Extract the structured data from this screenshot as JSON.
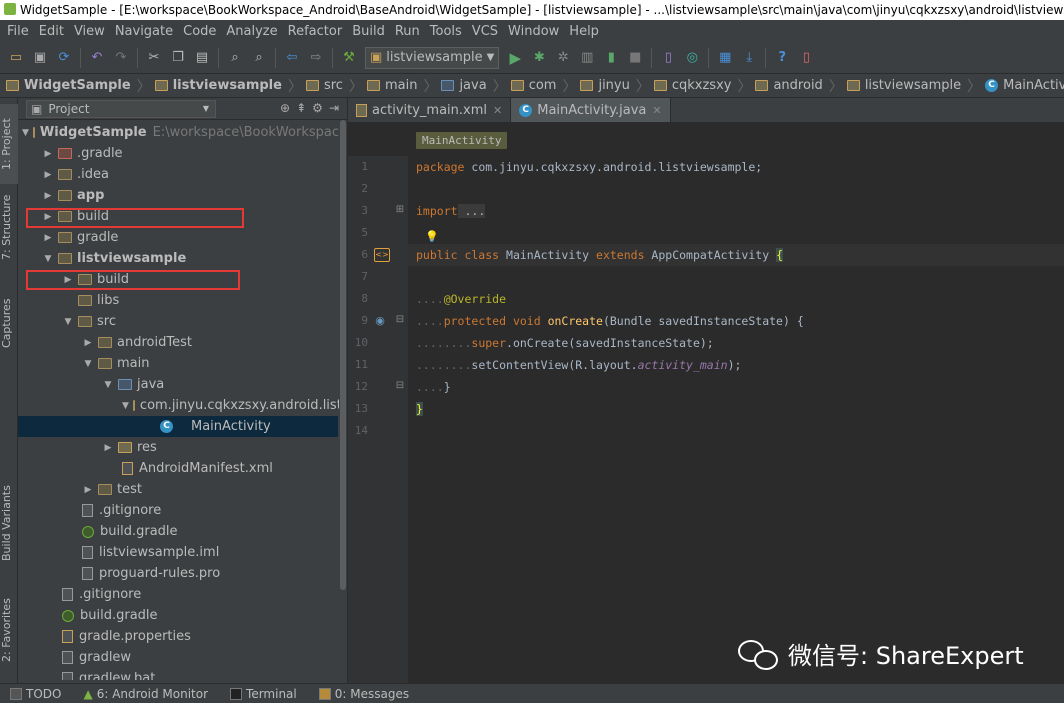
{
  "window": {
    "title": "WidgetSample - [E:\\workspace\\BookWorkspace_Android\\BaseAndroid\\WidgetSample] - [listviewsample] - ...\\listviewsample\\src\\main\\java\\com\\jinyu\\cqkxzsxy\\android\\listviewsample"
  },
  "menu": [
    "File",
    "Edit",
    "View",
    "Navigate",
    "Code",
    "Analyze",
    "Refactor",
    "Build",
    "Run",
    "Tools",
    "VCS",
    "Window",
    "Help"
  ],
  "toolbar": {
    "run_config": "listviewsample"
  },
  "navbar": [
    "WidgetSample",
    "listviewsample",
    "src",
    "main",
    "java",
    "com",
    "jinyu",
    "cqkxzsxy",
    "android",
    "listviewsample",
    "MainActivity"
  ],
  "sidebar_tabs": {
    "project": "1: Project",
    "structure": "7: Structure",
    "captures": "Captures",
    "build_variants": "Build Variants",
    "favorites": "2: Favorites"
  },
  "project": {
    "header": "Project",
    "root": {
      "name": "WidgetSample",
      "path": "E:\\workspace\\BookWorkspace_A"
    },
    "items": [
      {
        "name": ".gradle"
      },
      {
        "name": ".idea"
      },
      {
        "name": "app"
      },
      {
        "name": "build"
      },
      {
        "name": "gradle"
      },
      {
        "name": "listviewsample"
      },
      {
        "name": "build"
      },
      {
        "name": "libs"
      },
      {
        "name": "src"
      },
      {
        "name": "androidTest"
      },
      {
        "name": "main"
      },
      {
        "name": "java"
      },
      {
        "name": "com.jinyu.cqkxzsxy.android.listvie"
      },
      {
        "name": "MainActivity"
      },
      {
        "name": "res"
      },
      {
        "name": "AndroidManifest.xml"
      },
      {
        "name": "test"
      },
      {
        "name": ".gitignore"
      },
      {
        "name": "build.gradle"
      },
      {
        "name": "listviewsample.iml"
      },
      {
        "name": "proguard-rules.pro"
      },
      {
        "name": ".gitignore"
      },
      {
        "name": "build.gradle"
      },
      {
        "name": "gradle.properties"
      },
      {
        "name": "gradlew"
      },
      {
        "name": "gradlew.bat"
      }
    ]
  },
  "editor": {
    "tabs": [
      {
        "label": "activity_main.xml"
      },
      {
        "label": "MainActivity.java"
      }
    ],
    "breadcrumb": "MainActivity",
    "line_numbers": [
      "1",
      "2",
      "3",
      "5",
      "6",
      "7",
      "8",
      "9",
      "10",
      "11",
      "12",
      "13",
      "14"
    ],
    "code": {
      "l1_kw": "package",
      "l1_rest": " com.jinyu.cqkxzsxy.android.listviewsample;",
      "l3_kw": "import",
      "l3_rest": " ...",
      "l6_kw1": "public class",
      "l6_name": " MainActivity ",
      "l6_kw2": "extends",
      "l6_rest": " AppCompatActivity ",
      "l6_brace": "{",
      "l8": "@Override",
      "l9_kw": "protected void",
      "l9_fn": " onCreate",
      "l9_rest": "(Bundle savedInstanceState) {",
      "l10_kw": "super",
      "l10_rest": ".onCreate(savedInstanceState);",
      "l11_a": "setContentView(R.layout.",
      "l11_it": "activity_main",
      "l11_b": ");",
      "l12": "}",
      "l13": "}",
      "dots4": "....",
      "dots8": "........"
    }
  },
  "bottom": [
    {
      "label": "TODO"
    },
    {
      "label": "6: Android Monitor"
    },
    {
      "label": "Terminal"
    },
    {
      "label": "0: Messages"
    }
  ],
  "watermark": "微信号: ShareExpert",
  "colors": {
    "keyword": "#cc7832",
    "annotation": "#bbb529",
    "function": "#ffc66d",
    "field": "#9876aa",
    "highlight": "#e53935"
  }
}
